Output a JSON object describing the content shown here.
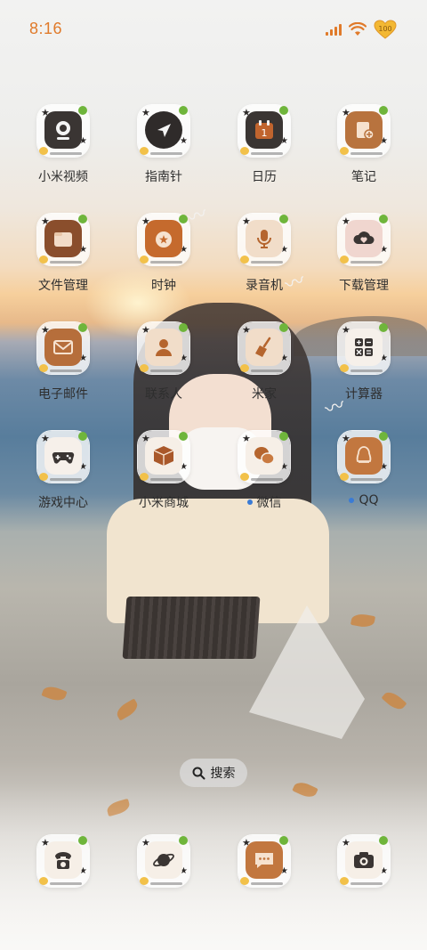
{
  "status_bar": {
    "time": "8:16",
    "battery_level": "100",
    "accent_color": "#e07a2a"
  },
  "apps": [
    {
      "label": "小米视频",
      "icon": "camera-icon"
    },
    {
      "label": "指南针",
      "icon": "compass-icon"
    },
    {
      "label": "日历",
      "icon": "calendar-icon",
      "date": "1"
    },
    {
      "label": "笔记",
      "icon": "notes-icon"
    },
    {
      "label": "文件管理",
      "icon": "folder-icon"
    },
    {
      "label": "时钟",
      "icon": "clock-icon"
    },
    {
      "label": "录音机",
      "icon": "microphone-icon"
    },
    {
      "label": "下载管理",
      "icon": "download-icon"
    },
    {
      "label": "电子邮件",
      "icon": "mail-icon"
    },
    {
      "label": "联系人",
      "icon": "contacts-icon"
    },
    {
      "label": "米家",
      "icon": "broom-icon"
    },
    {
      "label": "计算器",
      "icon": "calculator-icon"
    },
    {
      "label": "游戏中心",
      "icon": "gamepad-icon"
    },
    {
      "label": "小米商城",
      "icon": "box-icon"
    },
    {
      "label": "微信",
      "icon": "chat-bubbles-icon",
      "new_dot": true
    },
    {
      "label": "QQ",
      "icon": "penguin-icon",
      "new_dot": true
    }
  ],
  "search": {
    "label": "搜索"
  },
  "dock": [
    {
      "icon": "phone-icon"
    },
    {
      "icon": "planet-icon"
    },
    {
      "icon": "message-icon"
    },
    {
      "icon": "camera-shutter-icon"
    }
  ]
}
